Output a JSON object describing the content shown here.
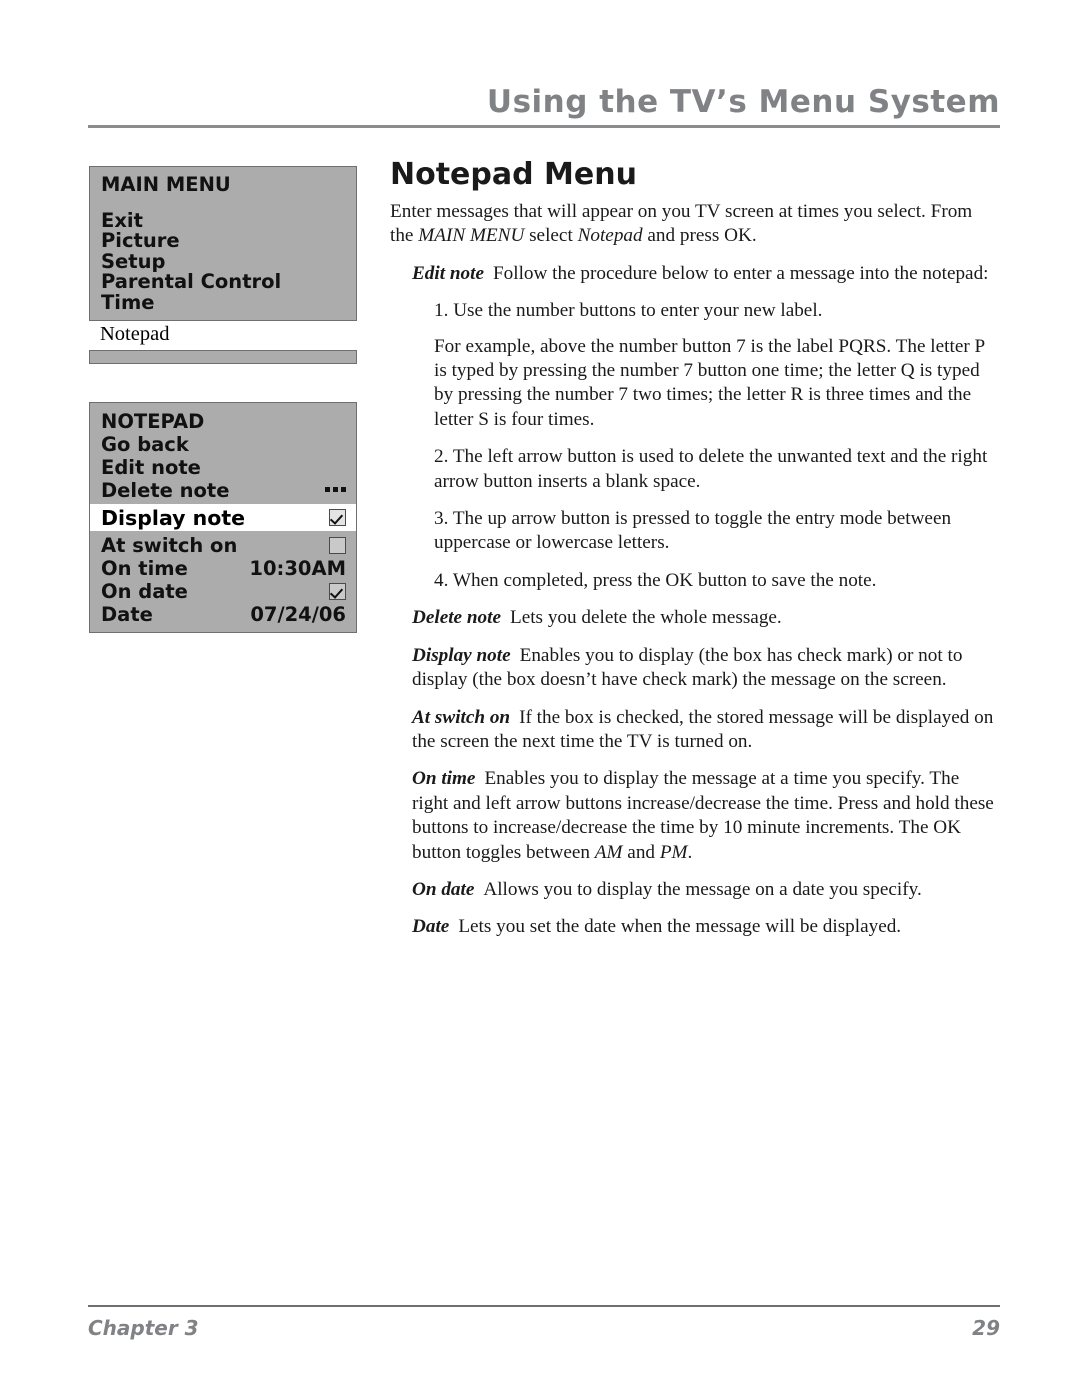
{
  "header": {
    "title": "Using the TV’s Menu System"
  },
  "osd": {
    "main_menu": {
      "title": "MAIN MENU",
      "items": [
        "Exit",
        "Picture",
        "Setup",
        "Parental Control",
        "Time"
      ],
      "selected_item": "Notepad"
    },
    "notepad_menu": {
      "title": "NOTEPAD",
      "rows_top": [
        {
          "label": "Go back",
          "value": ""
        },
        {
          "label": "Edit note",
          "value": ""
        },
        {
          "label": "Delete note",
          "value": "ellipsis-icon"
        }
      ],
      "selected_row": {
        "label": "Display note",
        "value": "checkbox-checked-icon"
      },
      "rows_bottom": [
        {
          "label": "At switch on",
          "value": "checkbox-unchecked-icon"
        },
        {
          "label": "On time",
          "value": "10:30AM"
        },
        {
          "label": "On date",
          "value": "checkbox-checked-icon"
        },
        {
          "label": "Date",
          "value": "07/24/06"
        }
      ]
    }
  },
  "content": {
    "section_title": "Notepad Menu",
    "intro_a": "Enter messages that will appear on you TV screen at times you select. From the ",
    "intro_b": "MAIN MENU",
    "intro_c": " select ",
    "intro_d": "Notepad",
    "intro_e": " and press OK.",
    "edit_note_term": "Edit note",
    "edit_note_text": "Follow the procedure below to enter a message into the notepad:",
    "step1": "1. Use the number buttons to enter your new label.",
    "step1_example": "For example, above the number button 7 is the label PQRS. The letter P is typed by pressing the number 7 button one time; the letter Q is typed by pressing the number 7 two times; the letter R is three times and the letter S is four times.",
    "step2": "2. The left arrow button is used to delete the unwanted text and the right arrow button inserts a blank space.",
    "step3": "3. The up arrow button is pressed to toggle the entry mode between uppercase or lowercase letters.",
    "step4": "4. When completed, press the OK button to save the note.",
    "delete_note_term": "Delete note",
    "delete_note_text": "Lets you delete the whole message.",
    "display_note_term": "Display note",
    "display_note_text": "Enables you to display (the box has check mark) or not to display (the box doesn’t have check mark) the message on the screen.",
    "at_switch_on_term": "At switch on",
    "at_switch_on_text": "If the box is checked, the stored message will be displayed on the screen the next time the TV is turned on.",
    "on_time_term": "On time",
    "on_time_text_a": "Enables you to display the message at a time you specify. The right and left arrow buttons increase/decrease the time. Press and hold these buttons to increase/decrease the time by 10 minute increments. The OK button toggles between ",
    "on_time_am": "AM",
    "on_time_text_b": " and ",
    "on_time_pm": "PM",
    "on_time_text_c": ".",
    "on_date_term": "On date",
    "on_date_text": "Allows you to display the message on a date you specify.",
    "date_term": "Date",
    "date_text": "Lets you set the date when the message will be displayed."
  },
  "footer": {
    "chapter": "Chapter 3",
    "page_number": "29"
  },
  "colors": {
    "osd_background": "#acacac",
    "osd_border": "#6f6f6f",
    "header_gray": "#808285",
    "text_black": "#1a1a1a"
  }
}
